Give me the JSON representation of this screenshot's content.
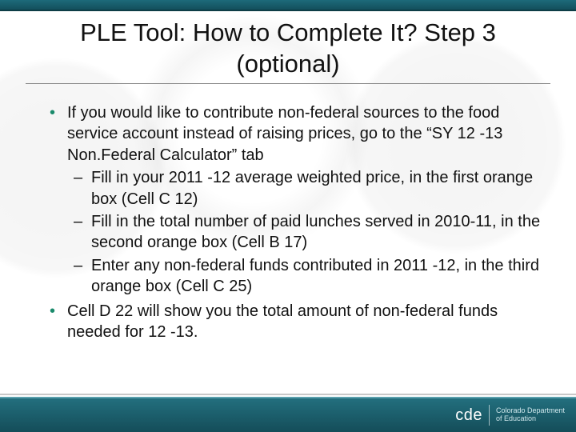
{
  "title": "PLE Tool: How to Complete It? Step 3 (optional)",
  "bullets": [
    {
      "text": "If you would like to contribute non-federal sources to the food service account instead of raising prices, go to the “SY 12 -13 Non.Federal Calculator” tab",
      "sub": [
        "Fill in your 2011 -12 average weighted price, in the first orange box (Cell C 12)",
        "Fill in the total number of paid lunches served in 2010-11, in the second orange box (Cell B 17)",
        "Enter any non-federal funds contributed in 2011 -12, in the third orange box (Cell C 25)"
      ]
    },
    {
      "text": "Cell D 22 will show you the total amount of non-federal funds needed for 12 -13.",
      "sub": []
    }
  ],
  "footer": {
    "logo_mark": "cde",
    "org_line1": "Colorado Department",
    "org_line2": "of Education"
  }
}
